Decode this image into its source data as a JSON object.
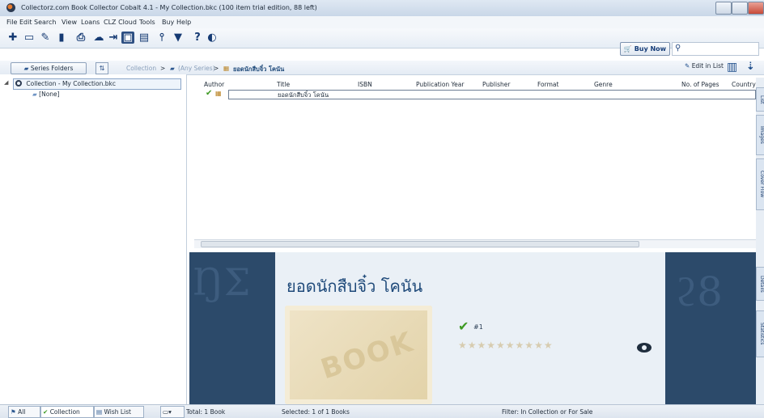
{
  "window": {
    "title": "Collectorz.com Book Collector Cobalt 4.1 - My Collection.bkc (100 item trial edition, 88 left)"
  },
  "menu": {
    "file": "File",
    "edit": "Edit",
    "search": "Search",
    "view": "View",
    "loans": "Loans",
    "clz_cloud": "CLZ Cloud",
    "tools": "Tools",
    "buy": "Buy",
    "help": "Help"
  },
  "toolbar": {
    "buy_now": "Buy Now",
    "search_placeholder": ""
  },
  "nav": {
    "series_folders": "Series Folders",
    "crumb_collection": "Collection",
    "crumb_any_series": "(Any Series)",
    "crumb_book": "ยอดนักสืบจิ๋ว โคนัน",
    "edit_in_list": "Edit in List"
  },
  "tree": {
    "root": "Collection - My Collection.bkc",
    "child": "[None]"
  },
  "list": {
    "columns": [
      "Author",
      "Title",
      "ISBN",
      "Publication Year",
      "Publisher",
      "Format",
      "Genre",
      "No. of Pages",
      "Country"
    ],
    "rows": [
      {
        "title": "ยอดนักสืบจิ๋ว โคนัน"
      }
    ]
  },
  "side_tabs": {
    "list": "List",
    "images": "Images",
    "cover_flow": "Cover Flow",
    "details": "Details",
    "statistics": "Statistics"
  },
  "details": {
    "title": "ยอดนักสืบจิ๋ว โคนัน",
    "number": "#1",
    "cover_word": "BOOK",
    "rating_stars": 10
  },
  "status": {
    "tab_all": "All",
    "tab_collection": "Collection",
    "tab_wishlist": "Wish List",
    "total": "Total: 1 Book",
    "selected": "Selected: 1 of 1 Books",
    "filter": "Filter: In Collection or For Sale"
  },
  "colors": {
    "accent": "#1f4a7a",
    "check": "#3e9a23",
    "detail_bg": "#2c4a6a"
  }
}
